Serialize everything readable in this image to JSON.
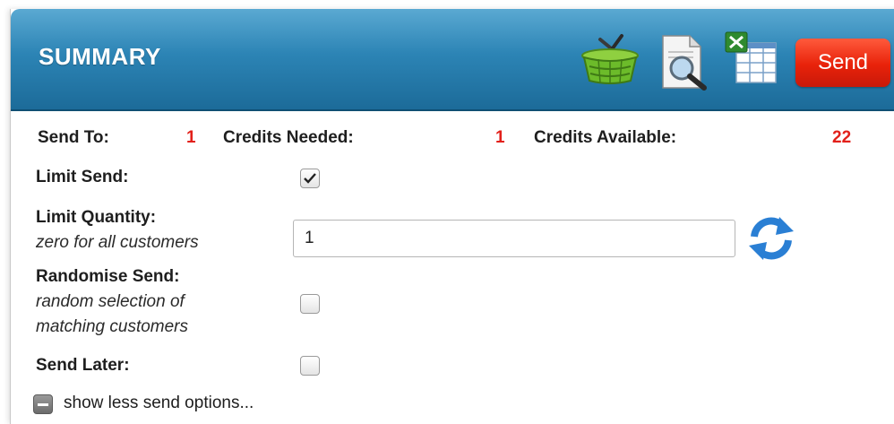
{
  "header": {
    "title": "SUMMARY",
    "send_label": "Send",
    "icons": [
      "basket-icon",
      "preview-document-icon",
      "excel-export-icon"
    ]
  },
  "stats": {
    "send_to_label": "Send To:",
    "send_to_value": "1",
    "credits_needed_label": "Credits Needed:",
    "credits_needed_value": "1",
    "credits_available_label": "Credits Available:",
    "credits_available_value": "22"
  },
  "options": {
    "limit_send_label": "Limit Send:",
    "limit_send_checked": true,
    "limit_quantity_label": "Limit Quantity:",
    "limit_quantity_hint": "zero for all customers",
    "limit_quantity_value": "1",
    "randomise_label": "Randomise Send:",
    "randomise_hint_1": "random selection of",
    "randomise_hint_2": "matching customers",
    "randomise_checked": false,
    "send_later_label": "Send Later:",
    "send_later_checked": false,
    "toggle_label": "show less send options..."
  },
  "colors": {
    "header": "#2c84b5",
    "send_button": "#e8220a",
    "value_red": "#e2201a"
  }
}
